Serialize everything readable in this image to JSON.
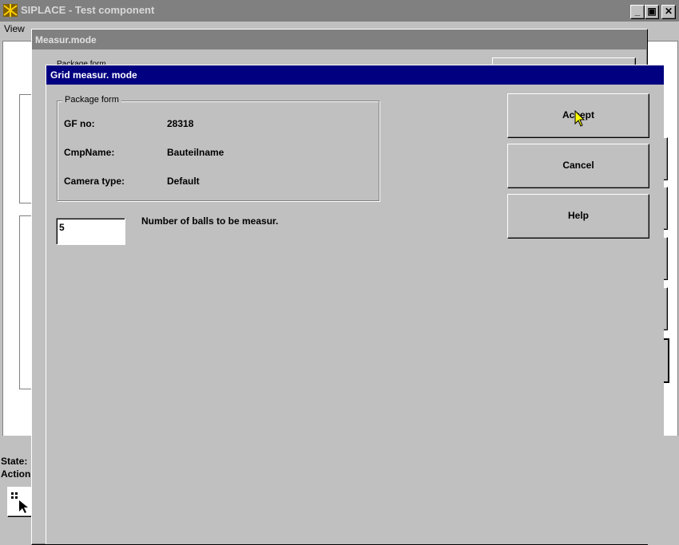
{
  "main_window": {
    "title": "SIPLACE - Test component",
    "menu": [
      "View"
    ],
    "status_state": "State:",
    "status_action": "Action"
  },
  "measur_dialog": {
    "title": "Measur.mode",
    "package_form_fragment": "Package form"
  },
  "grid_dialog": {
    "title": "Grid measur. mode",
    "package_form": {
      "legend": "Package form",
      "gf_label": "GF no:",
      "gf_value": "28318",
      "cmpname_label": "CmpName:",
      "cmpname_value": "Bauteilname",
      "camera_label": "Camera type:",
      "camera_value": "Default"
    },
    "balls_input_value": "5",
    "balls_label": "Number of balls to be measur.",
    "buttons": {
      "accept": "Accept",
      "cancel": "Cancel",
      "help": "Help"
    }
  },
  "colors": {
    "active_titlebar": "#000080",
    "inactive_titlebar": "#808080",
    "face": "#c0c0c0"
  }
}
